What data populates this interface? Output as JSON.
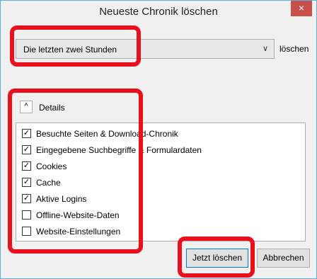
{
  "window": {
    "title": "Neueste Chronik löschen",
    "close_glyph": "×"
  },
  "range": {
    "selected": "Die letzten zwei Stunden",
    "suffix": "löschen"
  },
  "details": {
    "label": "Details",
    "toggle_glyph": "^"
  },
  "items": [
    {
      "label": "Besuchte Seiten & Download-Chronik",
      "checked": true
    },
    {
      "label": "Eingegebene Suchbegriffe & Formulardaten",
      "checked": true
    },
    {
      "label": "Cookies",
      "checked": true
    },
    {
      "label": "Cache",
      "checked": true
    },
    {
      "label": "Aktive Logins",
      "checked": true
    },
    {
      "label": "Offline-Website-Daten",
      "checked": false
    },
    {
      "label": "Website-Einstellungen",
      "checked": false
    }
  ],
  "buttons": {
    "clear_now": "Jetzt löschen",
    "cancel": "Abbrechen"
  },
  "colors": {
    "highlight": "#e8101d",
    "close": "#c7504b",
    "border": "#5eaee3"
  }
}
